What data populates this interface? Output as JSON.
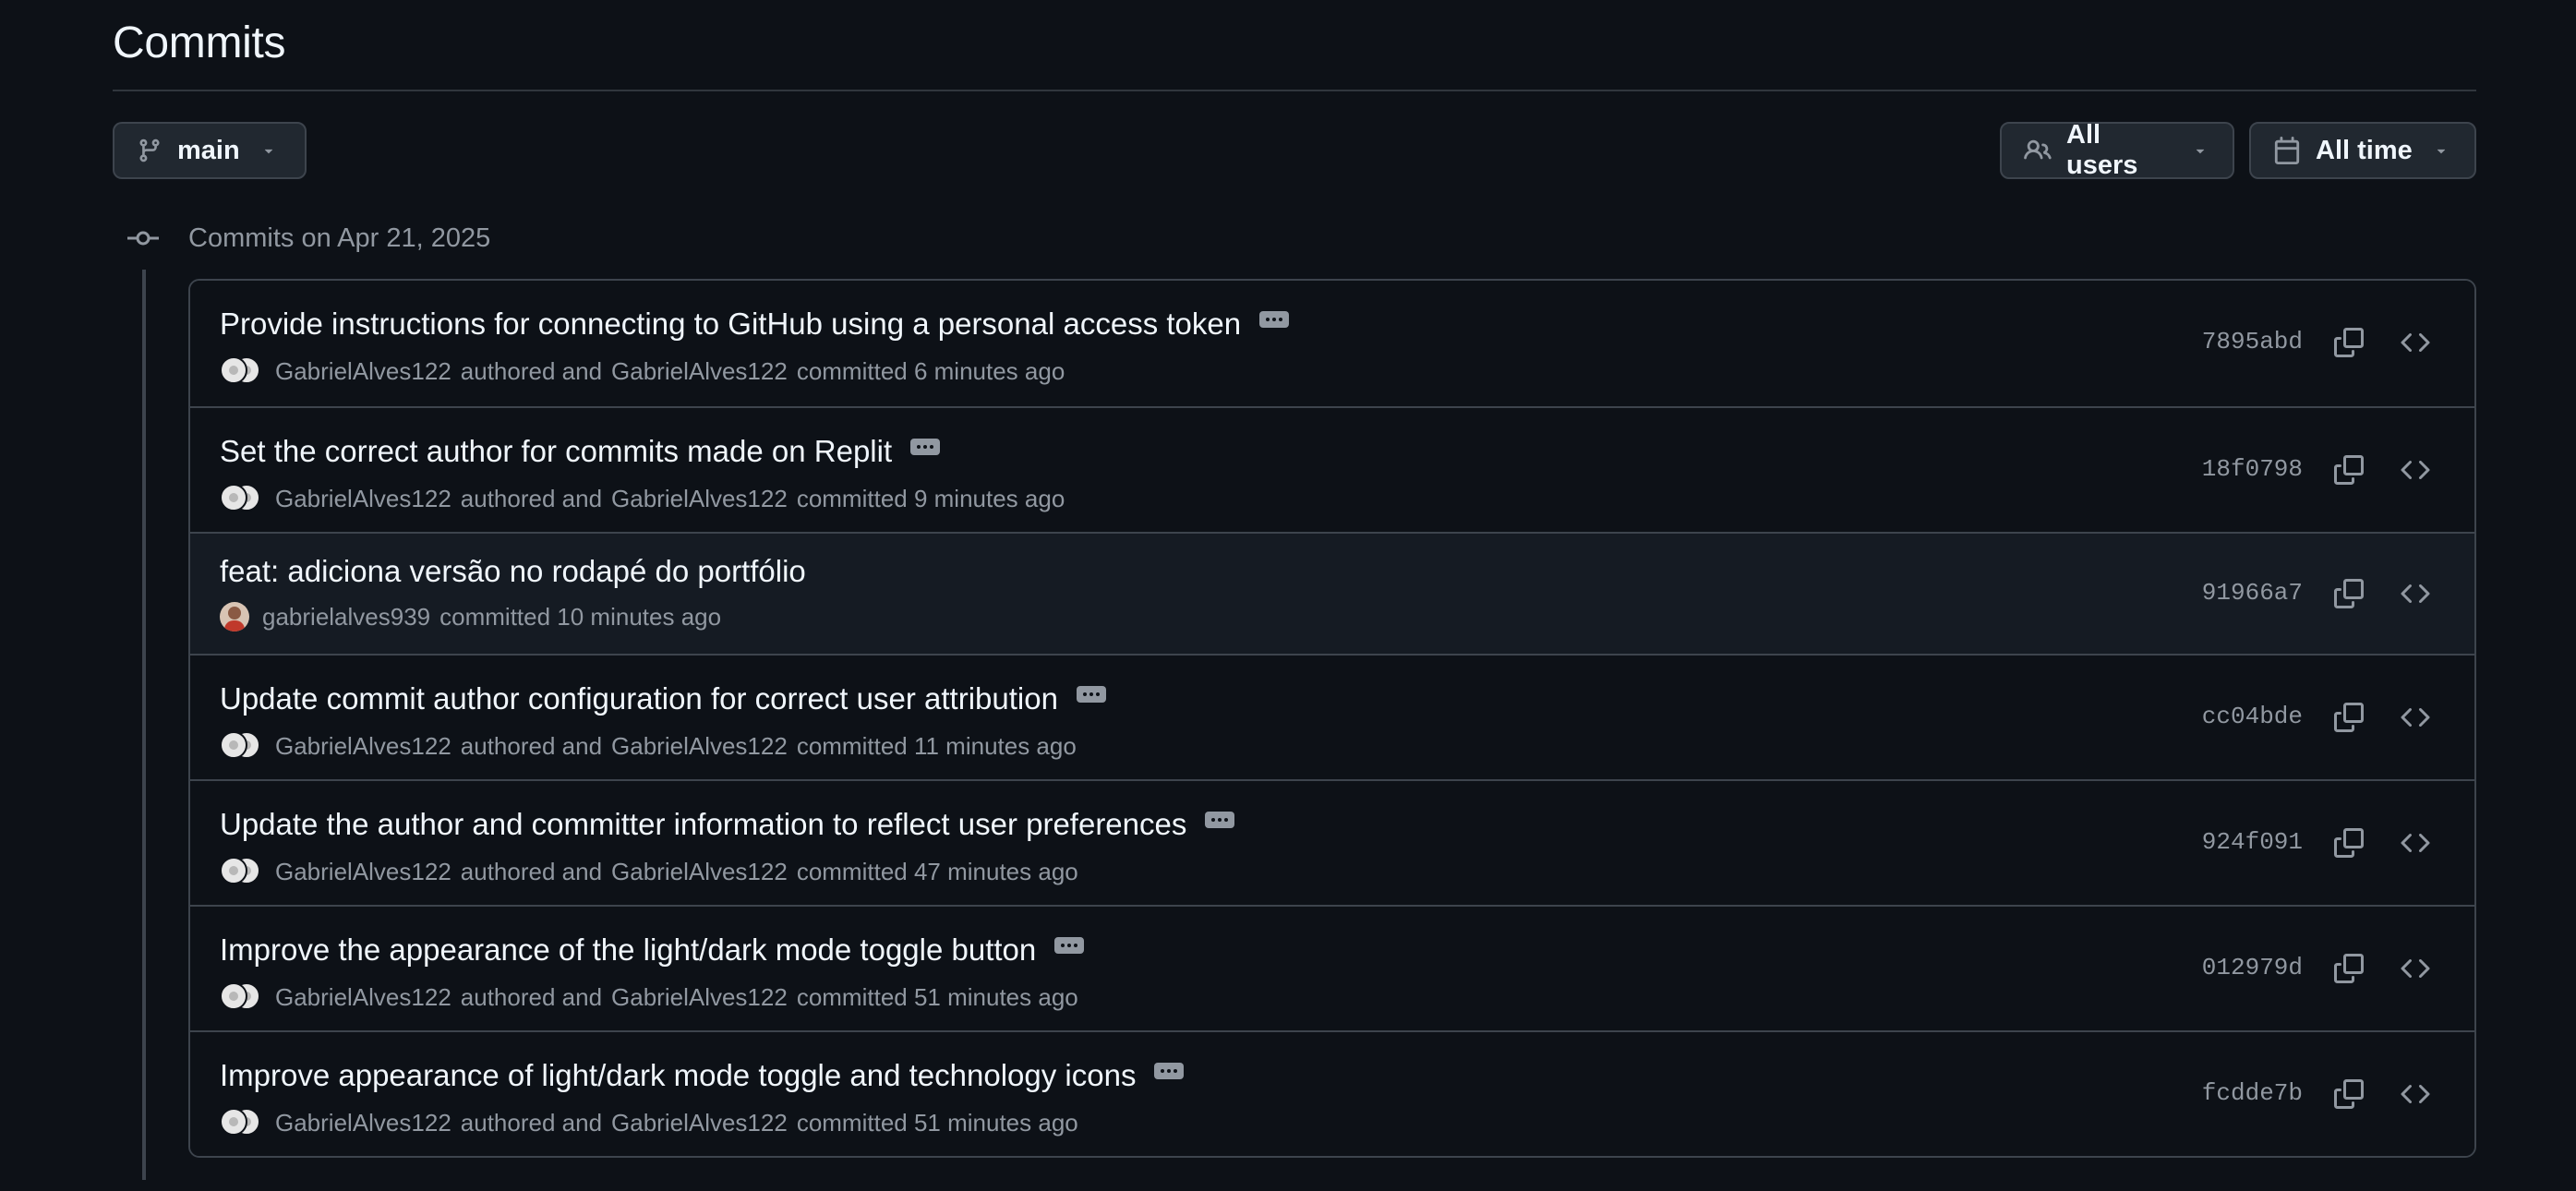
{
  "page": {
    "title": "Commits"
  },
  "toolbar": {
    "branch_label": "main",
    "users_label": "All users",
    "time_label": "All time"
  },
  "commit_group": {
    "label": "Commits on Apr 21, 2025"
  },
  "commits": [
    {
      "title": "Provide instructions for connecting to GitHub using a personal access token",
      "author": "GabrielAlves122",
      "authored_text": "authored and",
      "committer": "GabrielAlves122",
      "committed_text": "committed 6 minutes ago",
      "sha": "7895abd",
      "has_body": true,
      "single_author": false
    },
    {
      "title": "Set the correct author for commits made on Replit",
      "author": "GabrielAlves122",
      "authored_text": "authored and",
      "committer": "GabrielAlves122",
      "committed_text": "committed 9 minutes ago",
      "sha": "18f0798",
      "has_body": true,
      "single_author": false
    },
    {
      "title": "feat: adiciona versão no rodapé do portfólio",
      "author": "gabrielalves939",
      "committed_text": "committed 10 minutes ago",
      "sha": "91966a7",
      "has_body": false,
      "single_author": true
    },
    {
      "title": "Update commit author configuration for correct user attribution",
      "author": "GabrielAlves122",
      "authored_text": "authored and",
      "committer": "GabrielAlves122",
      "committed_text": "committed 11 minutes ago",
      "sha": "cc04bde",
      "has_body": true,
      "single_author": false
    },
    {
      "title": "Update the author and committer information to reflect user preferences",
      "author": "GabrielAlves122",
      "authored_text": "authored and",
      "committer": "GabrielAlves122",
      "committed_text": "committed 47 minutes ago",
      "sha": "924f091",
      "has_body": true,
      "single_author": false
    },
    {
      "title": "Improve the appearance of the light/dark mode toggle button",
      "author": "GabrielAlves122",
      "authored_text": "authored and",
      "committer": "GabrielAlves122",
      "committed_text": "committed 51 minutes ago",
      "sha": "012979d",
      "has_body": true,
      "single_author": false
    },
    {
      "title": "Improve appearance of light/dark mode toggle and technology icons",
      "author": "GabrielAlves122",
      "authored_text": "authored and",
      "committer": "GabrielAlves122",
      "committed_text": "committed 51 minutes ago",
      "sha": "fcdde7b",
      "has_body": true,
      "single_author": false
    }
  ],
  "icons": {
    "branch": "git-branch-icon",
    "users": "people-icon",
    "calendar": "calendar-icon",
    "caret": "triangle-down-icon",
    "commit": "git-commit-icon",
    "copy": "copy-icon",
    "browse": "code-icon",
    "ellipsis": "kebab-horizontal-icon"
  },
  "colors": {
    "background": "#0d1117",
    "row_highlight": "#151b23",
    "border": "#3d444d",
    "text_primary": "#f0f6fc",
    "text_muted": "#9198a1",
    "button_bg": "#212830"
  }
}
